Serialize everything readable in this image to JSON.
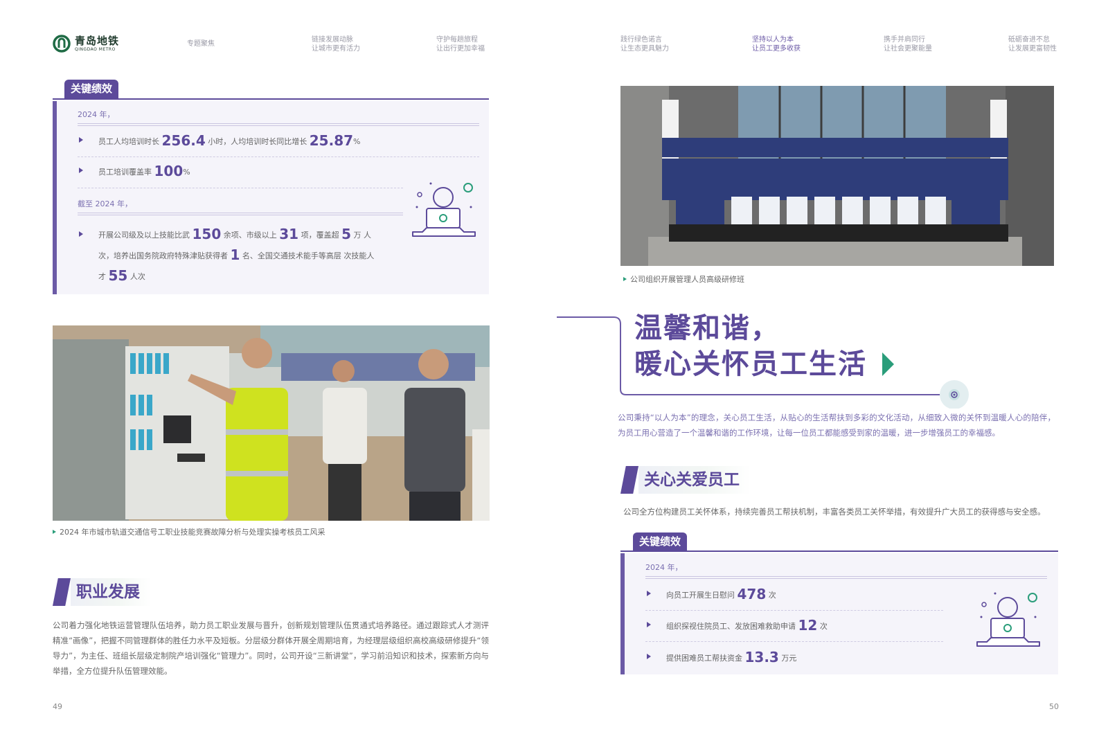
{
  "header": {
    "logo_cn": "青岛地铁",
    "logo_en": "QINGDAO METRO",
    "nav": [
      {
        "label": "专题聚焦"
      },
      {
        "line1": "链接发展动脉",
        "line2": "让城市更有活力"
      },
      {
        "line1": "守护每趟旅程",
        "line2": "让出行更加幸福"
      },
      {
        "line1": "践行绿色诺言",
        "line2": "让生态更具魅力"
      },
      {
        "line1": "坚持以人为本",
        "line2": "让员工更多收获"
      },
      {
        "line1": "携手并肩同行",
        "line2": "让社会更聚能量"
      },
      {
        "line1": "砥砺奋进不怠",
        "line2": "让发展更富韧性"
      }
    ]
  },
  "left": {
    "kp": {
      "tab": "关键绩效",
      "year1": "2024 年，",
      "r1_a": "员工人均培训时长",
      "r1_v1": "256.4",
      "r1_b": "小时，人均培训时长同比增长",
      "r1_v2": "25.87",
      "r1_c": "%",
      "r2_a": "员工培训覆盖率",
      "r2_v": "100",
      "r2_b": "%",
      "year2": "截至 2024 年，",
      "r3_a": "开展公司级及以上技能比武",
      "r3_v1": "150",
      "r3_b": "余项、市级以上",
      "r3_v2": "31",
      "r3_c": "项，覆盖超",
      "r3_v3": "5",
      "r3_d": "万",
      "r3_e": "人次，培养出国务院政府特殊津贴获得者",
      "r3_v4": "1",
      "r3_f": "名、全国交通技术能手等高层",
      "r3_g": "次技能人才",
      "r3_v5": "55",
      "r3_h": "人次"
    },
    "photo_caption": "2024 年市城市轨道交通信号工职业技能竞赛故障分析与处理实操考核员工风采",
    "career": {
      "title": "职业发展",
      "text": "公司着力强化地铁运营管理队伍培养，助力员工职业发展与晋升，创新规划管理队伍贯通式培养路径。通过跟踪式人才测评精准“画像”，把握不同管理群体的胜任力水平及短板。分层级分群体开展全周期培育，为经理层级组织高校高级研修提升“领导力”，为主任、班组长层级定制院产培训强化“管理力”。同时，公司开设“三新讲堂”，学习前沿知识和技术，探索新方向与举措，全方位提升队伍管理效能。"
    },
    "page_num": "49"
  },
  "right": {
    "photo_caption": "公司组织开展管理人员高级研修班",
    "head_line1": "温馨和谐，",
    "head_line2": "暖心关怀员工生活",
    "intro": "公司秉持“以人为本”的理念，关心员工生活，从贴心的生活帮扶到多彩的文化活动，从细致入微的关怀到温暖人心的陪伴，为员工用心营造了一个温馨和谐的工作环境，让每一位员工都能感受到家的温暖，进一步增强员工的幸福感。",
    "care": {
      "title": "关心关爱员工",
      "text": "公司全方位构建员工关怀体系，持续完善员工帮扶机制，丰富各类员工关怀举措，有效提升广大员工的获得感与安全感。"
    },
    "kp": {
      "tab": "关键绩效",
      "year": "2024 年，",
      "r1_a": "向员工开展生日慰问",
      "r1_v": "478",
      "r1_b": "次",
      "r2_a": "组织探视住院员工、发放困难救助申请",
      "r2_v": "12",
      "r2_b": "次",
      "r3_a": "提供困难员工帮扶资金",
      "r3_v": "13.3",
      "r3_b": "万元"
    },
    "page_num": "50"
  },
  "colors": {
    "brand_purple": "#5c4a9a",
    "accent_green": "#2a9d7a",
    "logo_green": "#1f6b45"
  }
}
